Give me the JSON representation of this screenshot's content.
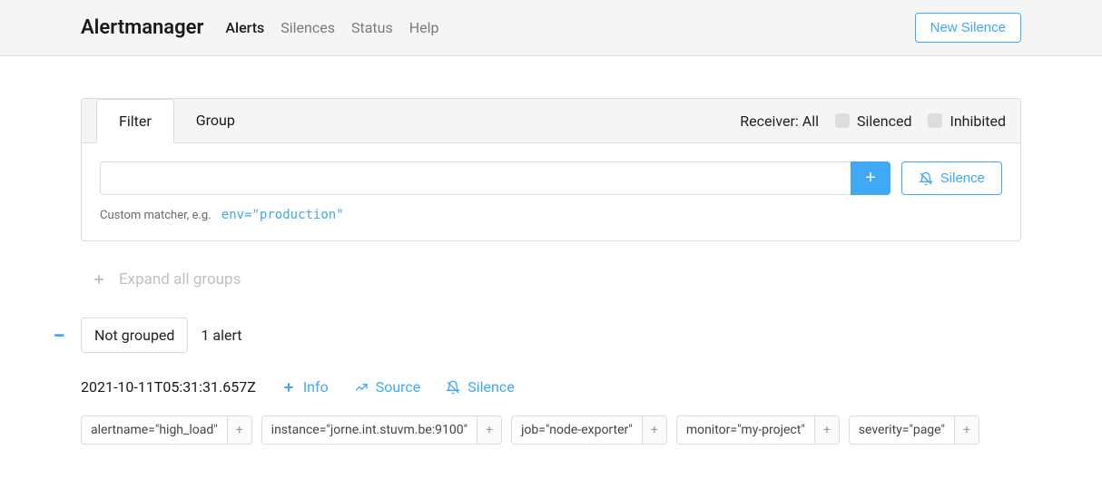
{
  "brand": "Alertmanager",
  "nav": {
    "alerts": "Alerts",
    "silences": "Silences",
    "status": "Status",
    "help": "Help"
  },
  "new_silence": "New Silence",
  "tabs": {
    "filter": "Filter",
    "group": "Group"
  },
  "receiver_label": "Receiver: All",
  "checkboxes": {
    "silenced": "Silenced",
    "inhibited": "Inhibited"
  },
  "filter": {
    "value": "",
    "hint_prefix": "Custom matcher, e.g.",
    "hint_example": "env=\"production\""
  },
  "actions": {
    "add_plus": "+",
    "silence": "Silence"
  },
  "expand_all": "Expand all groups",
  "group": {
    "label": "Not grouped",
    "count": "1 alert"
  },
  "alert": {
    "timestamp": "2021-10-11T05:31:31.657Z",
    "info": "Info",
    "source": "Source",
    "silence": "Silence",
    "tags": [
      "alertname=\"high_load\"",
      "instance=\"jorne.int.stuvm.be:9100\"",
      "job=\"node-exporter\"",
      "monitor=\"my-project\"",
      "severity=\"page\""
    ]
  }
}
